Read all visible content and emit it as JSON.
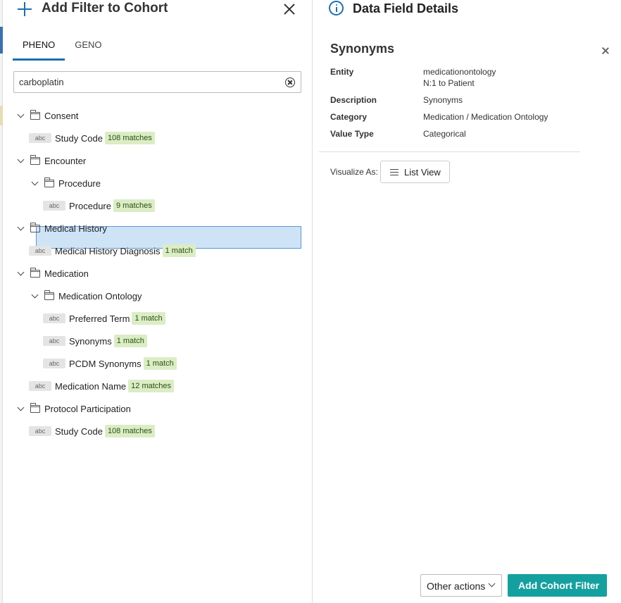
{
  "left_panel": {
    "title": "Add Filter to Cohort",
    "tabs": [
      {
        "label": "PHENO",
        "active": true
      },
      {
        "label": "GENO",
        "active": false
      }
    ],
    "search": {
      "value": "carboplatin"
    },
    "type_tag": "abc",
    "tree": [
      {
        "label": "Consent",
        "kind": "folder"
      },
      {
        "label": "Study Code",
        "kind": "field",
        "badge": "108 matches"
      },
      {
        "label": "Encounter",
        "kind": "folder"
      },
      {
        "label": "Procedure",
        "kind": "folder"
      },
      {
        "label": "Procedure",
        "kind": "field",
        "badge": "9 matches"
      },
      {
        "label": "Medical History",
        "kind": "folder"
      },
      {
        "label": "Medical History Diagnosis",
        "kind": "field",
        "badge": "1 match"
      },
      {
        "label": "Medication",
        "kind": "folder"
      },
      {
        "label": "Medication Ontology",
        "kind": "folder"
      },
      {
        "label": "Preferred Term",
        "kind": "field",
        "badge": "1 match"
      },
      {
        "label": "Synonyms",
        "kind": "field",
        "badge": "1 match",
        "selected": true
      },
      {
        "label": "PCDM Synonyms",
        "kind": "field",
        "badge": "1 match"
      },
      {
        "label": "Medication Name",
        "kind": "field",
        "badge": "12 matches"
      },
      {
        "label": "Protocol Participation",
        "kind": "folder"
      },
      {
        "label": "Study Code",
        "kind": "field",
        "badge": "108 matches"
      }
    ]
  },
  "right_panel": {
    "title": "Data Field Details",
    "field_name": "Synonyms",
    "details": {
      "entity_label": "Entity",
      "entity_value": "medicationontology",
      "entity_relation": "N:1 to Patient",
      "description_label": "Description",
      "description_value": "Synonyms",
      "category_label": "Category",
      "category_value": "Medication / Medication Ontology",
      "value_type_label": "Value Type",
      "value_type_value": "Categorical"
    },
    "visualize_label": "Visualize As:",
    "visualize_button": "List View",
    "other_actions_label": "Other actions",
    "add_filter_label": "Add Cohort Filter"
  }
}
